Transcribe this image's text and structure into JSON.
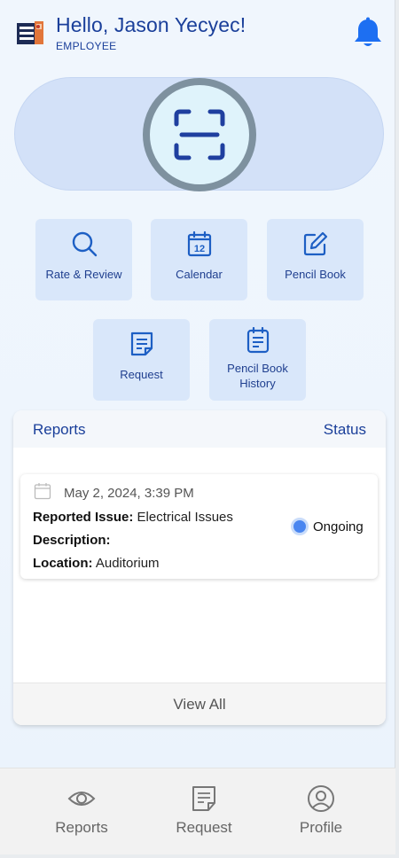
{
  "header": {
    "greeting": "Hello, Jason Yecyec!",
    "role": "EMPLOYEE",
    "icons": {
      "logo": "building-logo-icon",
      "notifications": "bell-icon"
    }
  },
  "scanner": {
    "icon": "scan-icon"
  },
  "actions": [
    {
      "label": "Rate & Review",
      "icon": "search-icon"
    },
    {
      "label": "Calendar",
      "icon": "calendar-icon",
      "icon_text": "12"
    },
    {
      "label": "Pencil Book",
      "icon": "edit-icon"
    },
    {
      "label": "Request",
      "icon": "document-icon"
    },
    {
      "label": "Pencil Book History",
      "icon": "clipboard-icon"
    }
  ],
  "reports": {
    "title": "Reports",
    "status_header": "Status",
    "items": [
      {
        "date": "May 2, 2024, 3:39 PM",
        "issue_label": "Reported Issue:",
        "issue": "Electrical Issues",
        "description_label": "Description:",
        "description": "",
        "location_label": "Location:",
        "location": "Auditorium",
        "status": "Ongoing"
      }
    ],
    "view_all": "View All"
  },
  "bottom_nav": [
    {
      "label": "Reports",
      "icon": "eye-icon"
    },
    {
      "label": "Request",
      "icon": "document-icon"
    },
    {
      "label": "Profile",
      "icon": "user-circle-icon"
    }
  ],
  "colors": {
    "brand_blue": "#1a3f9a",
    "icon_blue": "#1d5fc4",
    "tile_bg": "#d9e7fa",
    "status_ongoing": "#4a86f0"
  }
}
